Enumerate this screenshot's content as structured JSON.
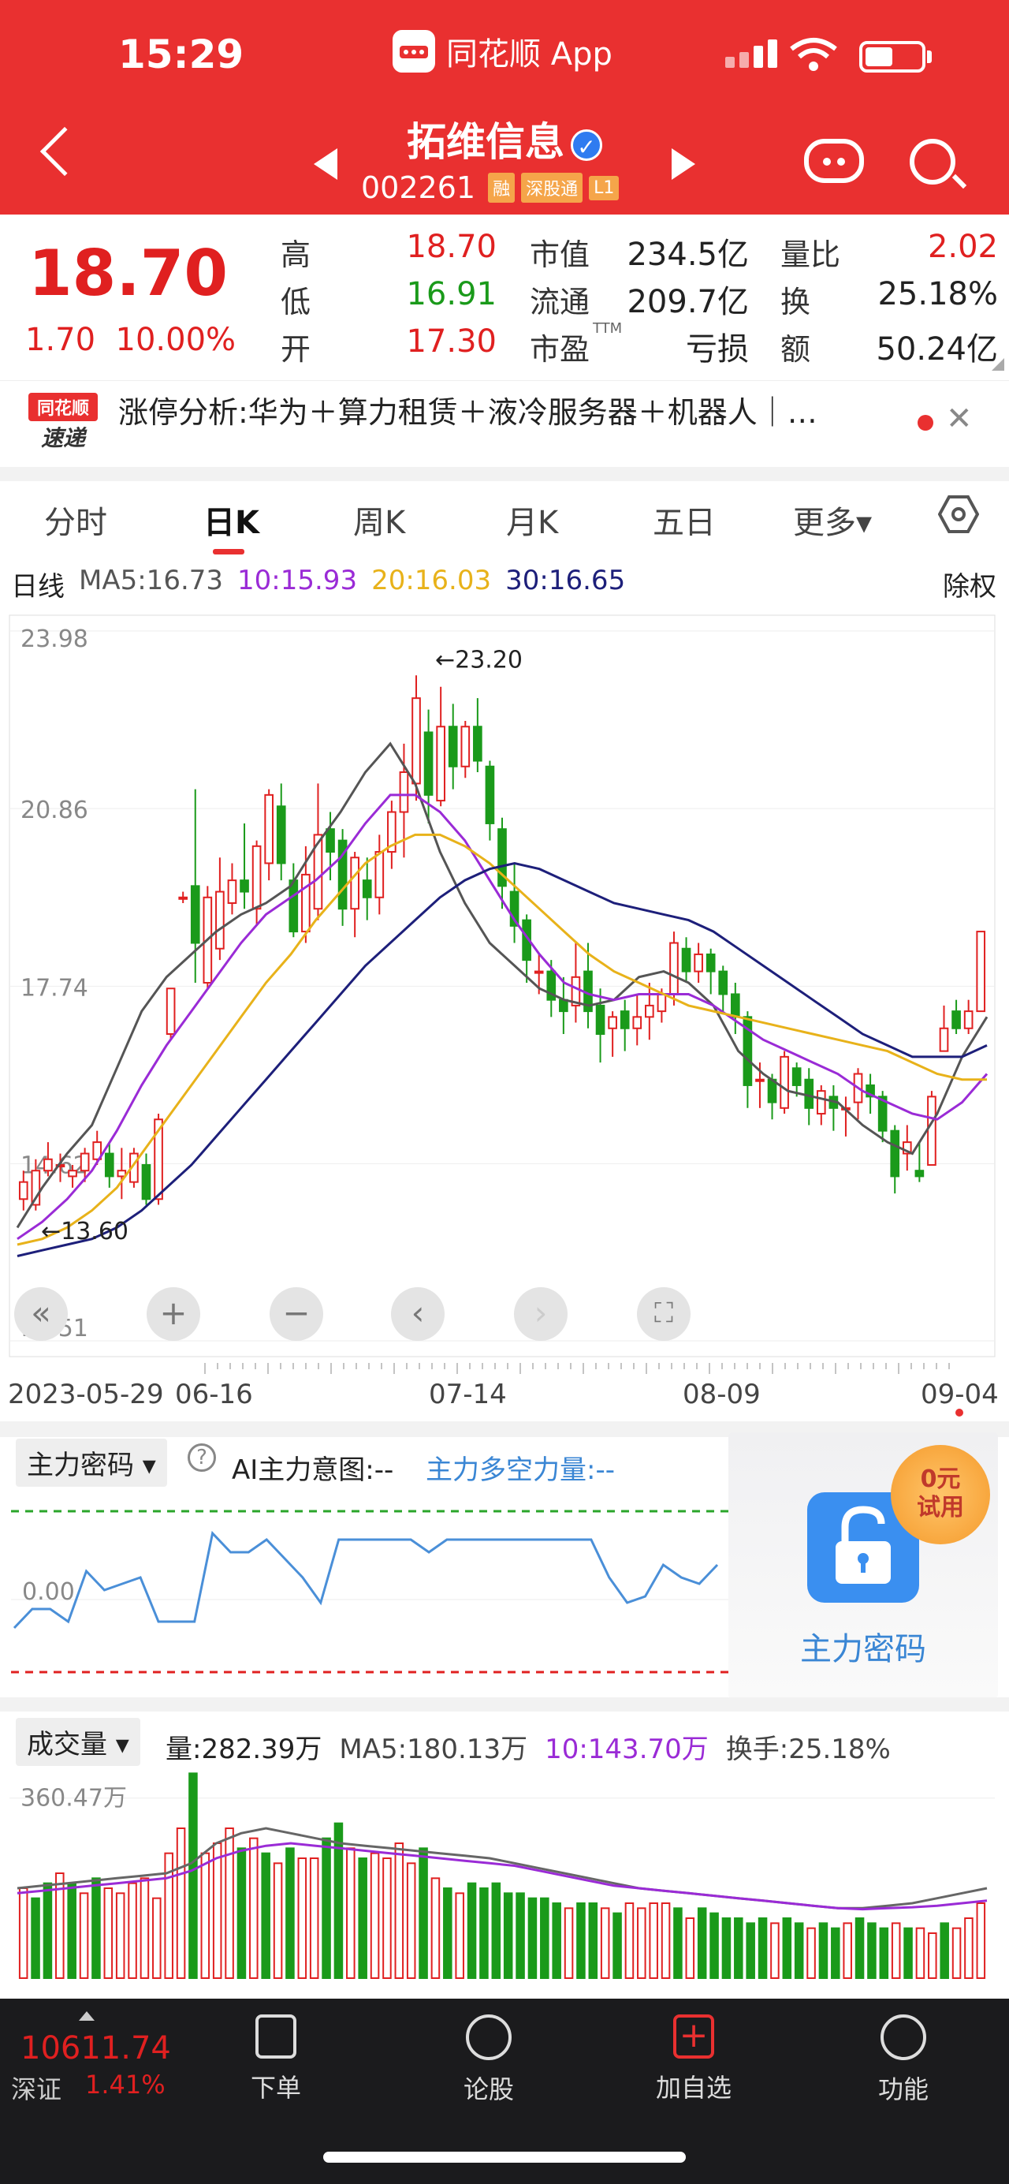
{
  "status": {
    "time": "15:29",
    "app_name": "同花顺 App"
  },
  "stock": {
    "name": "拓维信息",
    "code": "002261",
    "tags": [
      "融",
      "深股通",
      "L1"
    ]
  },
  "quote": {
    "price": "18.70",
    "change": "1.70",
    "change_pct": "10.00%",
    "high_label": "高",
    "high": "18.70",
    "low_label": "低",
    "low": "16.91",
    "open_label": "开",
    "open": "17.30",
    "mcap_label": "市值",
    "mcap": "234.5亿",
    "float_label": "流通",
    "float": "209.7亿",
    "pe_label": "市盈",
    "pe_sup": "TTM",
    "pe": "亏损",
    "vr_label": "量比",
    "vr": "2.02",
    "turn_label": "换",
    "turn": "25.18%",
    "amt_label": "额",
    "amt": "50.24亿"
  },
  "news": {
    "logo_top": "同花顺",
    "logo_bottom": "速递",
    "text": "涨停分析:华为＋算力租赁＋液冷服务器＋机器人｜…"
  },
  "tabs": [
    "分时",
    "日K",
    "周K",
    "月K",
    "五日",
    "更多▾"
  ],
  "active_tab": "日K",
  "ma": {
    "period": "日线",
    "ma5": "MA5:16.73",
    "ma10": "10:15.93",
    "ma20": "20:16.03",
    "ma30": "30:16.65",
    "adjust": "除权"
  },
  "colors": {
    "red": "#e02020",
    "green": "#1a9a1a",
    "ma5": "#555555",
    "ma10": "#9a2bd6",
    "ma20": "#e8b21a",
    "ma30": "#1d1f7a",
    "brand": "#e93030"
  },
  "chart_data": [
    {
      "type": "candlestick",
      "y_ticks": [
        "23.98",
        "20.86",
        "17.74",
        "14.62",
        "11.51"
      ],
      "ylim": [
        11.51,
        23.98
      ],
      "annotations": [
        {
          "text": "←23.20",
          "value": 23.2
        },
        {
          "text": "←13.60",
          "value": 13.6
        }
      ],
      "x_ticks": [
        "2023-05-29",
        "06-16",
        "07-14",
        "08-09",
        "09-04"
      ],
      "candles": [
        [
          14.0,
          14.3,
          13.8,
          14.5
        ],
        [
          13.9,
          14.5,
          13.8,
          14.7
        ],
        [
          14.5,
          14.7,
          14.4,
          15.0
        ],
        [
          14.6,
          14.6,
          14.3,
          14.8
        ],
        [
          14.4,
          14.5,
          14.2,
          14.6
        ],
        [
          14.5,
          14.8,
          14.3,
          14.9
        ],
        [
          14.7,
          15.0,
          14.6,
          15.2
        ],
        [
          14.8,
          14.4,
          14.2,
          15.0
        ],
        [
          14.4,
          14.5,
          14.0,
          14.9
        ],
        [
          14.3,
          14.8,
          14.2,
          14.9
        ],
        [
          14.6,
          14.0,
          13.9,
          14.8
        ],
        [
          14.0,
          15.4,
          13.9,
          15.5
        ],
        [
          16.9,
          17.7,
          16.8,
          17.7
        ],
        [
          19.3,
          19.3,
          19.2,
          19.4
        ],
        [
          19.5,
          18.5,
          17.8,
          21.2
        ],
        [
          17.8,
          19.3,
          17.7,
          19.5
        ],
        [
          18.4,
          19.4,
          18.2,
          20.0
        ],
        [
          19.2,
          19.6,
          19.0,
          19.9
        ],
        [
          19.6,
          19.4,
          19.1,
          20.6
        ],
        [
          19.1,
          20.2,
          18.8,
          20.3
        ],
        [
          19.9,
          21.1,
          19.6,
          21.2
        ],
        [
          20.9,
          19.9,
          19.6,
          21.3
        ],
        [
          19.6,
          18.7,
          18.6,
          19.9
        ],
        [
          18.7,
          19.7,
          18.5,
          20.2
        ],
        [
          19.1,
          20.4,
          18.9,
          21.3
        ],
        [
          20.5,
          20.1,
          19.6,
          20.8
        ],
        [
          20.3,
          19.1,
          18.8,
          20.5
        ],
        [
          19.1,
          20.0,
          18.6,
          20.1
        ],
        [
          19.6,
          19.3,
          18.9,
          20.0
        ],
        [
          19.3,
          20.1,
          19.0,
          20.4
        ],
        [
          20.1,
          20.8,
          19.8,
          21.0
        ],
        [
          20.8,
          21.5,
          20.0,
          22.0
        ],
        [
          21.3,
          22.8,
          21.0,
          23.2
        ],
        [
          22.2,
          21.1,
          20.6,
          22.6
        ],
        [
          21.0,
          22.3,
          20.9,
          23.0
        ],
        [
          22.3,
          21.6,
          21.2,
          22.7
        ],
        [
          21.6,
          22.3,
          21.4,
          22.4
        ],
        [
          22.3,
          21.7,
          21.5,
          22.8
        ],
        [
          21.6,
          20.6,
          20.3,
          21.7
        ],
        [
          20.5,
          19.5,
          19.1,
          20.7
        ],
        [
          19.4,
          18.8,
          18.5,
          19.9
        ],
        [
          18.9,
          18.2,
          17.8,
          19.0
        ],
        [
          18.0,
          18.0,
          17.6,
          18.3
        ],
        [
          18.0,
          17.5,
          17.2,
          18.2
        ],
        [
          17.5,
          17.3,
          16.9,
          17.9
        ],
        [
          17.4,
          17.9,
          17.1,
          18.5
        ],
        [
          18.0,
          17.3,
          17.0,
          18.5
        ],
        [
          17.4,
          16.9,
          16.4,
          17.7
        ],
        [
          17.0,
          17.2,
          16.5,
          17.3
        ],
        [
          17.3,
          17.0,
          16.6,
          17.5
        ],
        [
          17.0,
          17.2,
          16.7,
          17.6
        ],
        [
          17.2,
          17.4,
          16.8,
          17.8
        ],
        [
          17.3,
          17.6,
          17.1,
          17.7
        ],
        [
          17.6,
          18.5,
          17.4,
          18.7
        ],
        [
          18.4,
          18.0,
          17.8,
          18.6
        ],
        [
          18.0,
          18.3,
          17.8,
          18.5
        ],
        [
          18.3,
          18.0,
          17.6,
          18.4
        ],
        [
          18.0,
          17.6,
          17.3,
          18.1
        ],
        [
          17.6,
          17.2,
          16.9,
          17.8
        ],
        [
          17.2,
          16.0,
          15.6,
          17.3
        ],
        [
          16.1,
          16.1,
          15.6,
          16.4
        ],
        [
          16.1,
          15.7,
          15.4,
          16.2
        ],
        [
          15.6,
          16.5,
          15.5,
          16.6
        ],
        [
          16.3,
          16.0,
          15.8,
          16.4
        ],
        [
          16.1,
          15.6,
          15.3,
          16.3
        ],
        [
          15.5,
          15.9,
          15.3,
          16.0
        ],
        [
          15.8,
          15.6,
          15.2,
          16.0
        ],
        [
          15.6,
          15.6,
          15.1,
          15.8
        ],
        [
          15.7,
          16.2,
          15.4,
          16.3
        ],
        [
          16.0,
          15.8,
          15.5,
          16.2
        ],
        [
          15.8,
          15.2,
          15.0,
          15.9
        ],
        [
          15.2,
          14.4,
          14.1,
          15.3
        ],
        [
          14.8,
          15.0,
          14.5,
          15.3
        ],
        [
          14.5,
          14.4,
          14.3,
          15.0
        ],
        [
          14.6,
          15.8,
          14.6,
          15.9
        ],
        [
          16.6,
          17.0,
          16.6,
          17.4
        ],
        [
          17.3,
          17.0,
          16.9,
          17.5
        ],
        [
          17.0,
          17.3,
          16.9,
          17.5
        ],
        [
          17.3,
          18.7,
          17.3,
          18.7
        ]
      ],
      "series": [
        {
          "name": "MA5",
          "values": [
            13.5,
            14.2,
            14.8,
            15.3,
            16.3,
            17.3,
            17.9,
            18.3,
            18.7,
            19.0,
            19.2,
            19.5,
            20.2,
            20.8,
            21.5,
            22.0,
            21.3,
            20.1,
            19.2,
            18.5,
            18.1,
            17.7,
            17.5,
            17.4,
            17.5,
            17.9,
            18.0,
            17.8,
            17.4,
            16.6,
            16.2,
            15.9,
            15.8,
            15.7,
            15.3,
            15.0,
            14.8,
            15.5,
            16.5,
            17.2
          ]
        },
        {
          "name": "MA10",
          "values": [
            13.3,
            13.6,
            14.0,
            14.5,
            15.2,
            16.0,
            16.7,
            17.3,
            17.9,
            18.5,
            19.0,
            19.3,
            19.6,
            20.0,
            20.6,
            21.1,
            21.1,
            20.8,
            20.3,
            19.6,
            18.9,
            18.3,
            17.8,
            17.6,
            17.5,
            17.6,
            17.6,
            17.6,
            17.4,
            17.1,
            16.8,
            16.6,
            16.4,
            16.2,
            15.9,
            15.7,
            15.5,
            15.4,
            15.7,
            16.2
          ]
        },
        {
          "name": "MA20",
          "values": [
            13.2,
            13.3,
            13.5,
            13.8,
            14.2,
            14.8,
            15.4,
            16.0,
            16.6,
            17.2,
            17.8,
            18.3,
            18.9,
            19.4,
            19.9,
            20.2,
            20.4,
            20.4,
            20.2,
            19.9,
            19.5,
            19.1,
            18.7,
            18.3,
            18.0,
            17.8,
            17.6,
            17.4,
            17.3,
            17.2,
            17.1,
            17.0,
            16.9,
            16.8,
            16.7,
            16.6,
            16.4,
            16.2,
            16.1,
            16.1
          ]
        },
        {
          "name": "MA30",
          "values": [
            13.0,
            13.1,
            13.2,
            13.3,
            13.5,
            13.8,
            14.2,
            14.6,
            15.1,
            15.6,
            16.1,
            16.6,
            17.1,
            17.6,
            18.1,
            18.5,
            18.9,
            19.3,
            19.6,
            19.8,
            19.9,
            19.8,
            19.6,
            19.4,
            19.2,
            19.1,
            19.0,
            18.9,
            18.7,
            18.4,
            18.1,
            17.8,
            17.5,
            17.2,
            16.9,
            16.7,
            16.5,
            16.5,
            16.5,
            16.7
          ]
        }
      ]
    },
    {
      "type": "line",
      "name": "主力密码",
      "y_ticks": [
        "0.00"
      ],
      "values": [
        0.2,
        0.5,
        0.5,
        0.3,
        1.1,
        0.8,
        0.9,
        1.0,
        0.3,
        0.3,
        0.3,
        1.7,
        1.4,
        1.4,
        1.6,
        1.3,
        1.0,
        0.6,
        1.6,
        1.6,
        1.6,
        1.6,
        1.6,
        1.4,
        1.6,
        1.6,
        1.6,
        1.6,
        1.6,
        1.6,
        1.6,
        1.6,
        1.6,
        1.0,
        0.6,
        0.7,
        1.2,
        1.0,
        0.9,
        1.2
      ]
    },
    {
      "type": "bar",
      "name": "成交量",
      "y_ticks": [
        "360.47万"
      ],
      "values": [
        180,
        160,
        190,
        210,
        190,
        170,
        200,
        180,
        170,
        190,
        200,
        160,
        250,
        300,
        410,
        250,
        270,
        300,
        260,
        280,
        250,
        230,
        260,
        240,
        240,
        280,
        310,
        260,
        240,
        250,
        240,
        270,
        230,
        260,
        200,
        180,
        170,
        190,
        180,
        190,
        170,
        170,
        160,
        160,
        150,
        140,
        150,
        150,
        140,
        130,
        150,
        140,
        150,
        150,
        140,
        120,
        140,
        130,
        120,
        120,
        110,
        120,
        110,
        120,
        110,
        100,
        110,
        100,
        110,
        120,
        110,
        100,
        110,
        100,
        100,
        90,
        110,
        100,
        120,
        150
      ],
      "colors": [
        "r",
        "g",
        "g",
        "r",
        "g",
        "r",
        "g",
        "r",
        "r",
        "r",
        "r",
        "r",
        "r",
        "r",
        "g",
        "r",
        "r",
        "r",
        "g",
        "r",
        "g",
        "r",
        "g",
        "r",
        "r",
        "g",
        "g",
        "r",
        "g",
        "r",
        "r",
        "r",
        "r",
        "g",
        "r",
        "g",
        "r",
        "g",
        "g",
        "g",
        "g",
        "g",
        "g",
        "g",
        "g",
        "r",
        "g",
        "g",
        "r",
        "g",
        "r",
        "r",
        "r",
        "r",
        "g",
        "r",
        "g",
        "g",
        "g",
        "g",
        "g",
        "g",
        "r",
        "g",
        "g",
        "r",
        "g",
        "g",
        "r",
        "g",
        "g",
        "g",
        "r",
        "g",
        "r",
        "r",
        "g",
        "r",
        "r",
        "r"
      ],
      "series": [
        {
          "name": "MA5",
          "values": [
            180,
            185,
            190,
            195,
            200,
            205,
            210,
            230,
            270,
            290,
            300,
            290,
            280,
            270,
            265,
            260,
            255,
            250,
            245,
            240,
            230,
            220,
            210,
            200,
            190,
            180,
            175,
            170,
            165,
            160,
            155,
            150,
            145,
            140,
            140,
            145,
            150,
            160,
            170,
            180
          ]
        },
        {
          "name": "MA10",
          "values": [
            170,
            175,
            180,
            185,
            190,
            195,
            200,
            215,
            240,
            255,
            265,
            270,
            265,
            260,
            255,
            250,
            245,
            240,
            235,
            230,
            225,
            215,
            205,
            195,
            185,
            180,
            175,
            170,
            165,
            160,
            155,
            150,
            145,
            140,
            138,
            140,
            142,
            145,
            150,
            155
          ]
        }
      ]
    }
  ],
  "indicator": {
    "select": "主力密码 ▾",
    "help": "?",
    "ai_label": "AI主力意图:--",
    "power_label": "主力多空力量:--",
    "lock_label": "主力密码",
    "trial_line1": "0元",
    "trial_line2": "试用"
  },
  "volume": {
    "select": "成交量 ▾",
    "vol": "量:282.39万",
    "ma5": "MA5:180.13万",
    "ma10": "10:143.70万",
    "turnover": "换手:25.18%"
  },
  "index": {
    "value": "10611.74",
    "name": "深证",
    "pct": "1.41%"
  },
  "bottom_nav": [
    "下单",
    "论股",
    "加自选",
    "功能"
  ]
}
